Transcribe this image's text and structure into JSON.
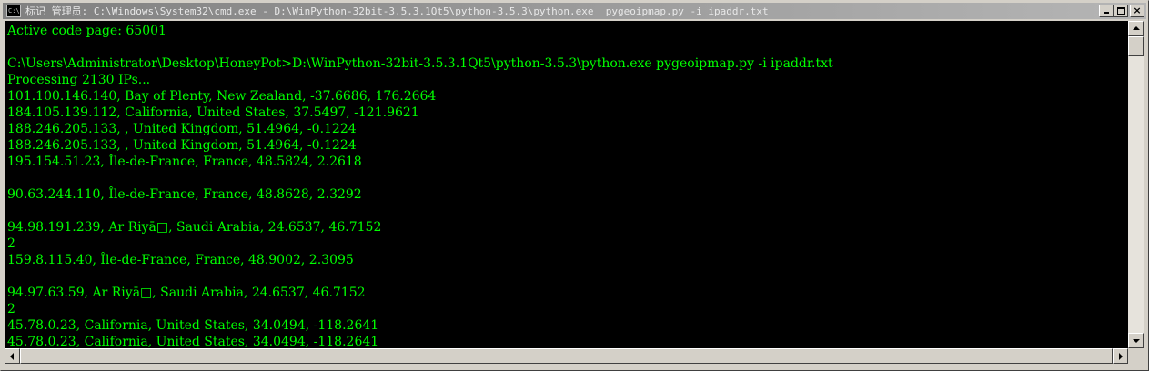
{
  "window": {
    "title": "标记 管理员: C:\\Windows\\System32\\cmd.exe - D:\\WinPython-32bit-3.5.3.1Qt5\\python-3.5.3\\python.exe  pygeoipmap.py -i ipaddr.txt",
    "icon_label": "C:\\",
    "icon": "console-icon",
    "buttons": {
      "minimize": "minimize-icon",
      "maximize": "maximize-icon",
      "close": "×"
    }
  },
  "console": {
    "text_color": "#00ff00",
    "background": "#000000",
    "lines": [
      "Active code page: 65001",
      "",
      "C:\\Users\\Administrator\\Desktop\\HoneyPot>D:\\WinPython-32bit-3.5.3.1Qt5\\python-3.5.3\\python.exe pygeoipmap.py -i ipaddr.txt",
      "Processing 2130 IPs...",
      "101.100.146.140, Bay of Plenty, New Zealand, -37.6686, 176.2664",
      "184.105.139.112, California, United States, 37.5497, -121.9621",
      "188.246.205.133, , United Kingdom, 51.4964, -0.1224",
      "188.246.205.133, , United Kingdom, 51.4964, -0.1224",
      "195.154.51.23, Île-de-France, France, 48.5824, 2.2618",
      "",
      "90.63.244.110, Île-de-France, France, 48.8628, 2.3292",
      "",
      "94.98.191.239, Ar Riyā□, Saudi Arabia, 24.6537, 46.7152",
      "2",
      "159.8.115.40, Île-de-France, France, 48.9002, 2.3095",
      "",
      "94.97.63.59, Ar Riyā□, Saudi Arabia, 24.6537, 46.7152",
      "2",
      "45.78.0.23, California, United States, 34.0494, -118.2641",
      "45.78.0.23, California, United States, 34.0494, -118.2641"
    ]
  },
  "scrollbars": {
    "up": "scroll-up-arrow",
    "down": "scroll-down-arrow",
    "left": "scroll-left-arrow",
    "right": "scroll-right-arrow"
  }
}
